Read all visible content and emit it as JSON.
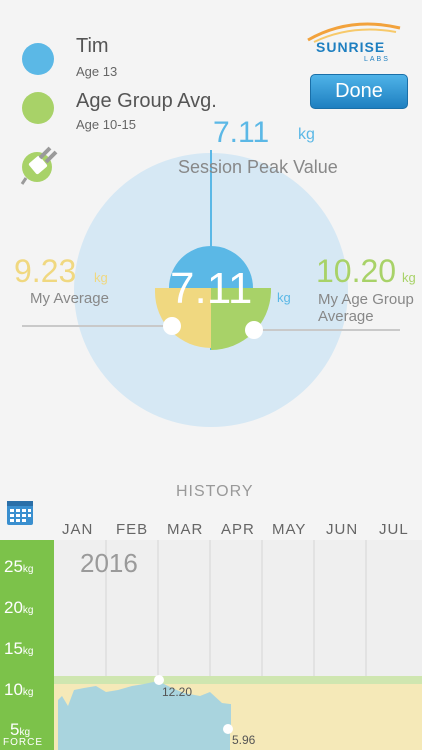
{
  "legend": {
    "user_name": "Tim",
    "user_age": "Age 13",
    "group_name": "Age Group Avg.",
    "group_age": "Age 10-15"
  },
  "brand": {
    "name": "SUNRISE",
    "sub": "LABS"
  },
  "done_label": "Done",
  "session": {
    "value": "7.11",
    "unit": "kg",
    "label": "Session Peak Value"
  },
  "gauge": {
    "center_value": "7.11",
    "center_unit": "kg"
  },
  "my_average": {
    "value": "9.23",
    "unit": "kg",
    "label": "My Average"
  },
  "group_average": {
    "value": "10.20",
    "unit": "kg",
    "label_line1": "My Age Group",
    "label_line2": "Average"
  },
  "history": {
    "title": "HISTORY",
    "year": "2016",
    "months": [
      "JAN",
      "FEB",
      "MAR",
      "APR",
      "MAY",
      "JUN",
      "JUL"
    ],
    "y_labels": [
      {
        "value": "25",
        "unit": "kg"
      },
      {
        "value": "20",
        "unit": "kg"
      },
      {
        "value": "15",
        "unit": "kg"
      },
      {
        "value": "10",
        "unit": "kg"
      },
      {
        "value": "5",
        "unit": "kg"
      }
    ],
    "axis_name": "FORCE",
    "point_labels": [
      "12.20",
      "5.96"
    ]
  },
  "colors": {
    "blue": "#5bb8e6",
    "yellow": "#f0d880",
    "green": "#a8d268",
    "light_circle": "#d6e8f4",
    "axis_green": "#7cc24a"
  },
  "icons": {
    "calendar": "calendar-icon",
    "plug": "plug-icon"
  }
}
